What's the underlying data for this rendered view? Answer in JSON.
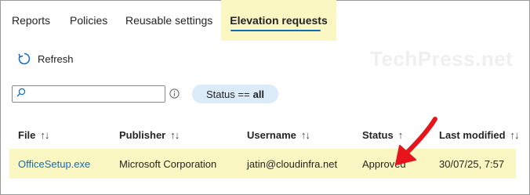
{
  "tabs": [
    {
      "label": "Reports"
    },
    {
      "label": "Policies"
    },
    {
      "label": "Reusable settings"
    },
    {
      "label": "Elevation requests",
      "active": true
    }
  ],
  "toolbar": {
    "refresh_label": "Refresh",
    "refresh_icon": "refresh-icon"
  },
  "watermark": "TechPress.net",
  "search": {
    "value": "",
    "placeholder": "",
    "icon": "search-icon"
  },
  "filter": {
    "prefix": "Status ==",
    "value": "all",
    "info_icon": "info-icon"
  },
  "table": {
    "columns": [
      {
        "label": "File",
        "sort": "↑↓"
      },
      {
        "label": "Publisher",
        "sort": "↑↓"
      },
      {
        "label": "Username",
        "sort": "↑↓"
      },
      {
        "label": "Status",
        "sort": "↑"
      },
      {
        "label": "Last modified",
        "sort": "↑↓"
      }
    ],
    "rows": [
      {
        "file": "OfficeSetup.exe",
        "publisher": "Microsoft Corporation",
        "username": "jatin@cloudinfra.net",
        "status": "Approved",
        "last_modified": "30/07/25, 7:57"
      }
    ]
  },
  "colors": {
    "accent": "#0f6cbd",
    "highlight": "#fbf7c2",
    "pill": "#dcebf8",
    "annotation_arrow": "#e8141c"
  }
}
